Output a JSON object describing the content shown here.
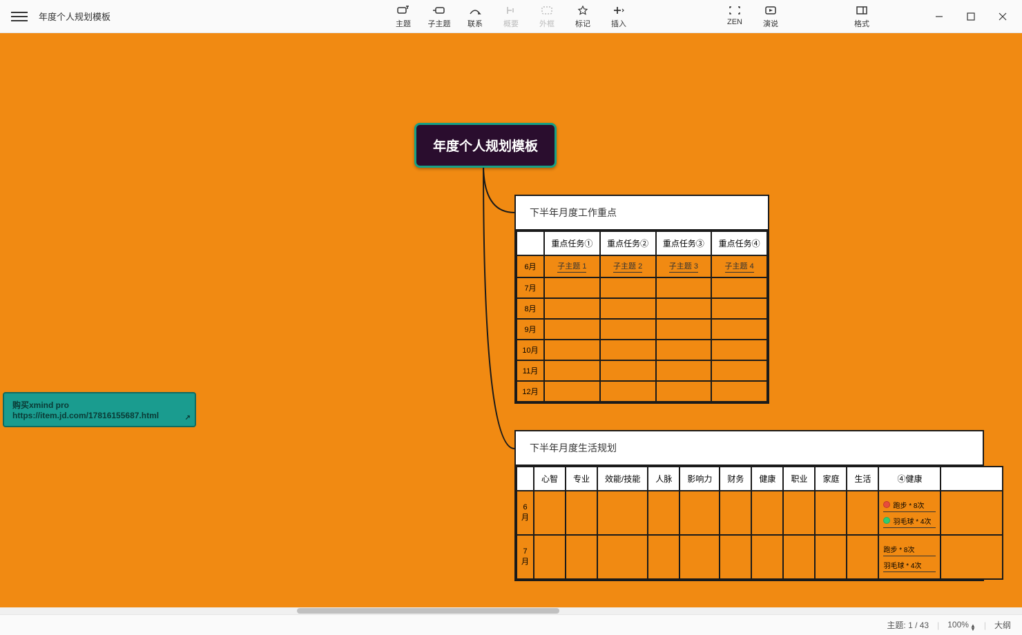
{
  "doc_title": "年度个人规划模板",
  "toolbar": {
    "items": [
      {
        "id": "topic",
        "label": "主题"
      },
      {
        "id": "subtopic",
        "label": "子主题"
      },
      {
        "id": "relation",
        "label": "联系"
      },
      {
        "id": "summary",
        "label": "概要",
        "disabled": true
      },
      {
        "id": "boundary",
        "label": "外框",
        "disabled": true
      },
      {
        "id": "marker",
        "label": "标记"
      },
      {
        "id": "insert",
        "label": "插入"
      }
    ],
    "right_mid": [
      {
        "id": "zen",
        "label": "ZEN"
      },
      {
        "id": "present",
        "label": "演说"
      }
    ],
    "right_far": [
      {
        "id": "format",
        "label": "格式"
      }
    ]
  },
  "central_topic": "年度个人规划模板",
  "float_topic": {
    "line1": "购买xmind pro",
    "line2": "https://item.jd.com/17816155687.html"
  },
  "panel1": {
    "title": "下半年月度工作重点",
    "headers": [
      "重点任务①",
      "重点任务②",
      "重点任务③",
      "重点任务④"
    ],
    "months": [
      "6月",
      "7月",
      "8月",
      "9月",
      "10月",
      "11月",
      "12月"
    ],
    "row0": [
      "子主题 1",
      "子主题 2",
      "子主题 3",
      "子主题 4"
    ]
  },
  "panel2": {
    "title": "下半年月度生活规划",
    "headers": [
      "心智",
      "专业",
      "效能/技能",
      "人脉",
      "影响力",
      "财务",
      "健康",
      "职业",
      "家庭",
      "生活",
      "④健康"
    ],
    "months": [
      "6月",
      "7月"
    ],
    "health_items_6": [
      {
        "color": "red",
        "text": "跑步 * 8次"
      },
      {
        "color": "green",
        "text": "羽毛球 * 4次"
      }
    ],
    "health_items_7": [
      {
        "text": "跑步 * 8次"
      },
      {
        "text": "羽毛球 * 4次"
      }
    ]
  },
  "status": {
    "topic_label": "主题:",
    "topic_count": "1 / 43",
    "zoom": "100%",
    "outline": "大纲"
  }
}
